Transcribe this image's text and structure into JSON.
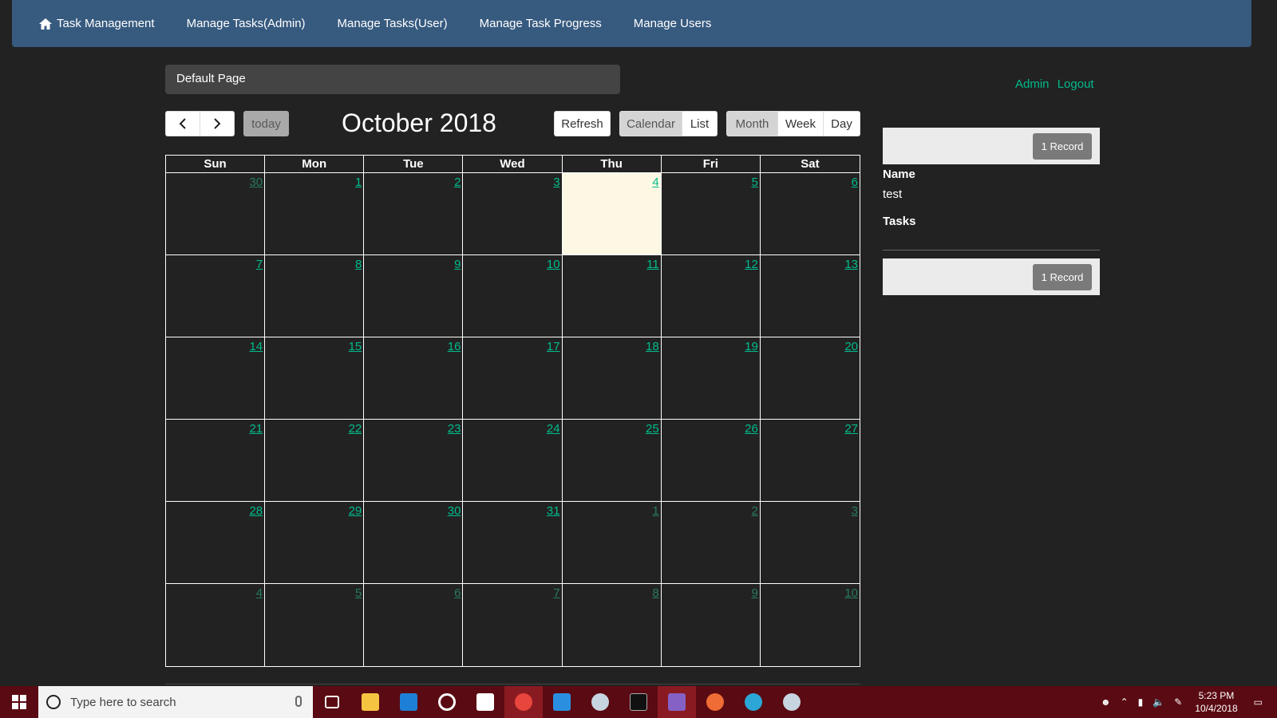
{
  "nav": {
    "brand": "Task Management",
    "links": [
      "Manage Tasks(Admin)",
      "Manage Tasks(User)",
      "Manage Task Progress",
      "Manage Users"
    ]
  },
  "breadcrumb": "Default Page",
  "user": {
    "name": "Admin",
    "logout": "Logout"
  },
  "toolbar": {
    "prev": "‹",
    "next": "›",
    "today": "today",
    "title": "October 2018",
    "refresh": "Refresh",
    "calendar": "Calendar",
    "list": "List",
    "month": "Month",
    "week": "Week",
    "day": "Day"
  },
  "calendar": {
    "weekdays": [
      "Sun",
      "Mon",
      "Tue",
      "Wed",
      "Thu",
      "Fri",
      "Sat"
    ],
    "days": [
      {
        "n": "30",
        "o": true
      },
      {
        "n": "1"
      },
      {
        "n": "2"
      },
      {
        "n": "3"
      },
      {
        "n": "4",
        "t": true
      },
      {
        "n": "5"
      },
      {
        "n": "6"
      },
      {
        "n": "7"
      },
      {
        "n": "8"
      },
      {
        "n": "9"
      },
      {
        "n": "10"
      },
      {
        "n": "11"
      },
      {
        "n": "12"
      },
      {
        "n": "13"
      },
      {
        "n": "14"
      },
      {
        "n": "15"
      },
      {
        "n": "16"
      },
      {
        "n": "17"
      },
      {
        "n": "18"
      },
      {
        "n": "19"
      },
      {
        "n": "20"
      },
      {
        "n": "21"
      },
      {
        "n": "22"
      },
      {
        "n": "23"
      },
      {
        "n": "24"
      },
      {
        "n": "25"
      },
      {
        "n": "26"
      },
      {
        "n": "27"
      },
      {
        "n": "28"
      },
      {
        "n": "29"
      },
      {
        "n": "30"
      },
      {
        "n": "31"
      },
      {
        "n": "1",
        "o": true
      },
      {
        "n": "2",
        "o": true
      },
      {
        "n": "3",
        "o": true
      },
      {
        "n": "4",
        "o": true
      },
      {
        "n": "5",
        "o": true
      },
      {
        "n": "6",
        "o": true
      },
      {
        "n": "7",
        "o": true
      },
      {
        "n": "8",
        "o": true
      },
      {
        "n": "9",
        "o": true
      },
      {
        "n": "10",
        "o": true
      }
    ]
  },
  "side": {
    "record_label": "1 Record",
    "name_label": "Name",
    "name_value": "test",
    "tasks_label": "Tasks"
  },
  "taskbar": {
    "search_placeholder": "Type here to search",
    "time": "5:23 PM",
    "date": "10/4/2018",
    "apps": [
      {
        "name": "task-view-icon",
        "color": "#5a0a12"
      },
      {
        "name": "file-explorer-icon",
        "color": "#f5c542"
      },
      {
        "name": "edge-icon",
        "color": "#1e7fd6"
      },
      {
        "name": "groove-icon",
        "color": "#ffffff"
      },
      {
        "name": "store-icon",
        "color": "#ffffff"
      },
      {
        "name": "chrome-icon",
        "color": "#e8453c"
      },
      {
        "name": "vscode-icon",
        "color": "#2b8fe0"
      },
      {
        "name": "steam-icon",
        "color": "#c7d5e0"
      },
      {
        "name": "terminal-icon",
        "color": "#111111"
      },
      {
        "name": "visual-studio-icon",
        "color": "#8661c5"
      },
      {
        "name": "postman-icon",
        "color": "#ef6c35"
      },
      {
        "name": "tower-icon",
        "color": "#2ba6d6"
      },
      {
        "name": "steam2-icon",
        "color": "#c7d5e0"
      }
    ]
  },
  "colors": {
    "accent": "#00bc8c",
    "navbar": "#375a7f",
    "today": "#fcf8e3"
  }
}
